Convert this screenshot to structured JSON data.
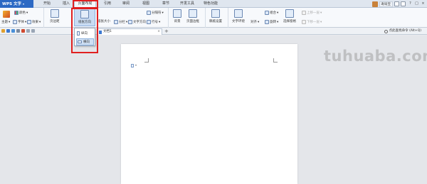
{
  "app": {
    "name": "WPS 文字",
    "menu_arrow": "▾"
  },
  "tabs": [
    "开始",
    "插入",
    "页面布局",
    "引用",
    "审阅",
    "视图",
    "章节",
    "开发工具",
    "特色功能"
  ],
  "active_tab_index": 2,
  "user": {
    "name": "寿局宝"
  },
  "window_controls": [
    "?",
    "□",
    "×"
  ],
  "ribbon": {
    "theme": "主题",
    "colors": "颜色",
    "fonts": "字体",
    "effects": "效果",
    "margins": "页边距",
    "orientation": "纸张方向",
    "size": "纸张大小",
    "columns": "分栏",
    "text_direction": "文字方向",
    "breaks": "分隔符",
    "line_numbers": "行号",
    "background": "背景",
    "page_borders": "页面边框",
    "draft_setup": "稿纸设置",
    "text_wrap": "文字环绕",
    "align": "对齐",
    "group": "组合",
    "rotate": "旋转",
    "selection_pane": "选择窗格",
    "bring_forward": "上移一层",
    "send_backward": "下移一层"
  },
  "orientation_menu": {
    "portrait": "纵向",
    "landscape": "横向",
    "selected": "横向"
  },
  "document_tab": {
    "name": "文档1",
    "close": "×",
    "add": "+"
  },
  "command_search": {
    "label": "点此查找命令 (Alt+Q)"
  },
  "watermark": "tuhuaba.com",
  "colors": {
    "accent": "#2c69c4",
    "highlight": "#e02020"
  }
}
